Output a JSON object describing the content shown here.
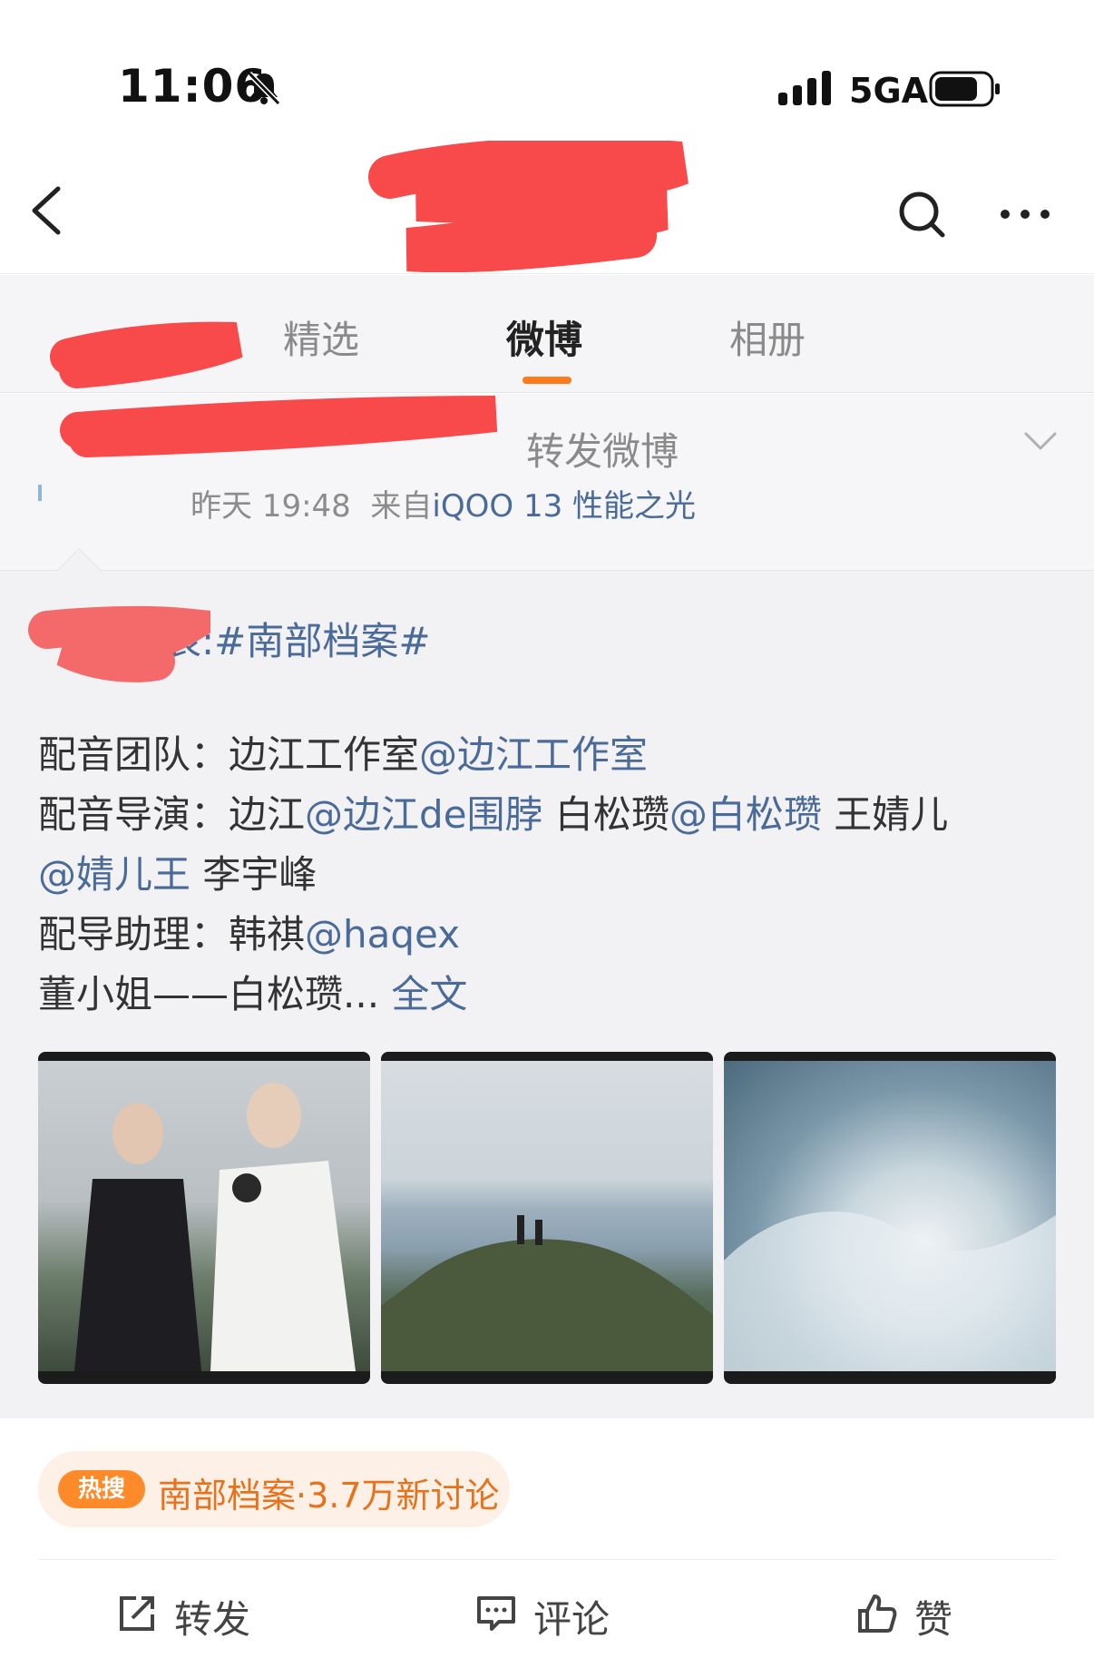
{
  "status_bar": {
    "time": "11:06",
    "network": "5GA",
    "icons": [
      "bell-slash-icon",
      "signal-icon",
      "battery-icon"
    ]
  },
  "nav": {
    "icons": [
      "back-icon",
      "search-icon",
      "more-icon"
    ]
  },
  "tabs": [
    {
      "label": "精选",
      "active": false
    },
    {
      "label": "微博",
      "active": true
    },
    {
      "label": "相册",
      "active": false
    }
  ],
  "post": {
    "repost_label": "转发微博",
    "meta_time": "昨天 19:48",
    "meta_from": "来自",
    "meta_source": "iQOO 13 性能之光"
  },
  "retweet": {
    "topic_line": "表:#南部档案#",
    "lines": {
      "l1_label": "配音团队：",
      "l1_text": "边江工作室",
      "l1_link": "@边江工作室",
      "l2_label": "配音导演：",
      "l2_text1": "边江",
      "l2_link1": "@边江de围脖",
      "l2_text2": "白松瓒",
      "l2_link2": "@白松瓒",
      "l2_text3": "王婧儿",
      "l3_link": "@婧儿王",
      "l3_text": "李宇峰",
      "l4_label": "配导助理：",
      "l4_text": "韩祺",
      "l4_link": "@haqex",
      "l5_text": "董小姐——白松瓒...",
      "l5_link": "全文"
    }
  },
  "hot_search": {
    "badge": "热搜",
    "text": "南部档案·3.7万新讨论"
  },
  "actions": {
    "share": "转发",
    "comment": "评论",
    "like": "赞"
  },
  "colors": {
    "accent": "#ff7a1a",
    "link": "#4a6a9a",
    "hot": "#e8721c",
    "redaction": "#f84a4a"
  }
}
